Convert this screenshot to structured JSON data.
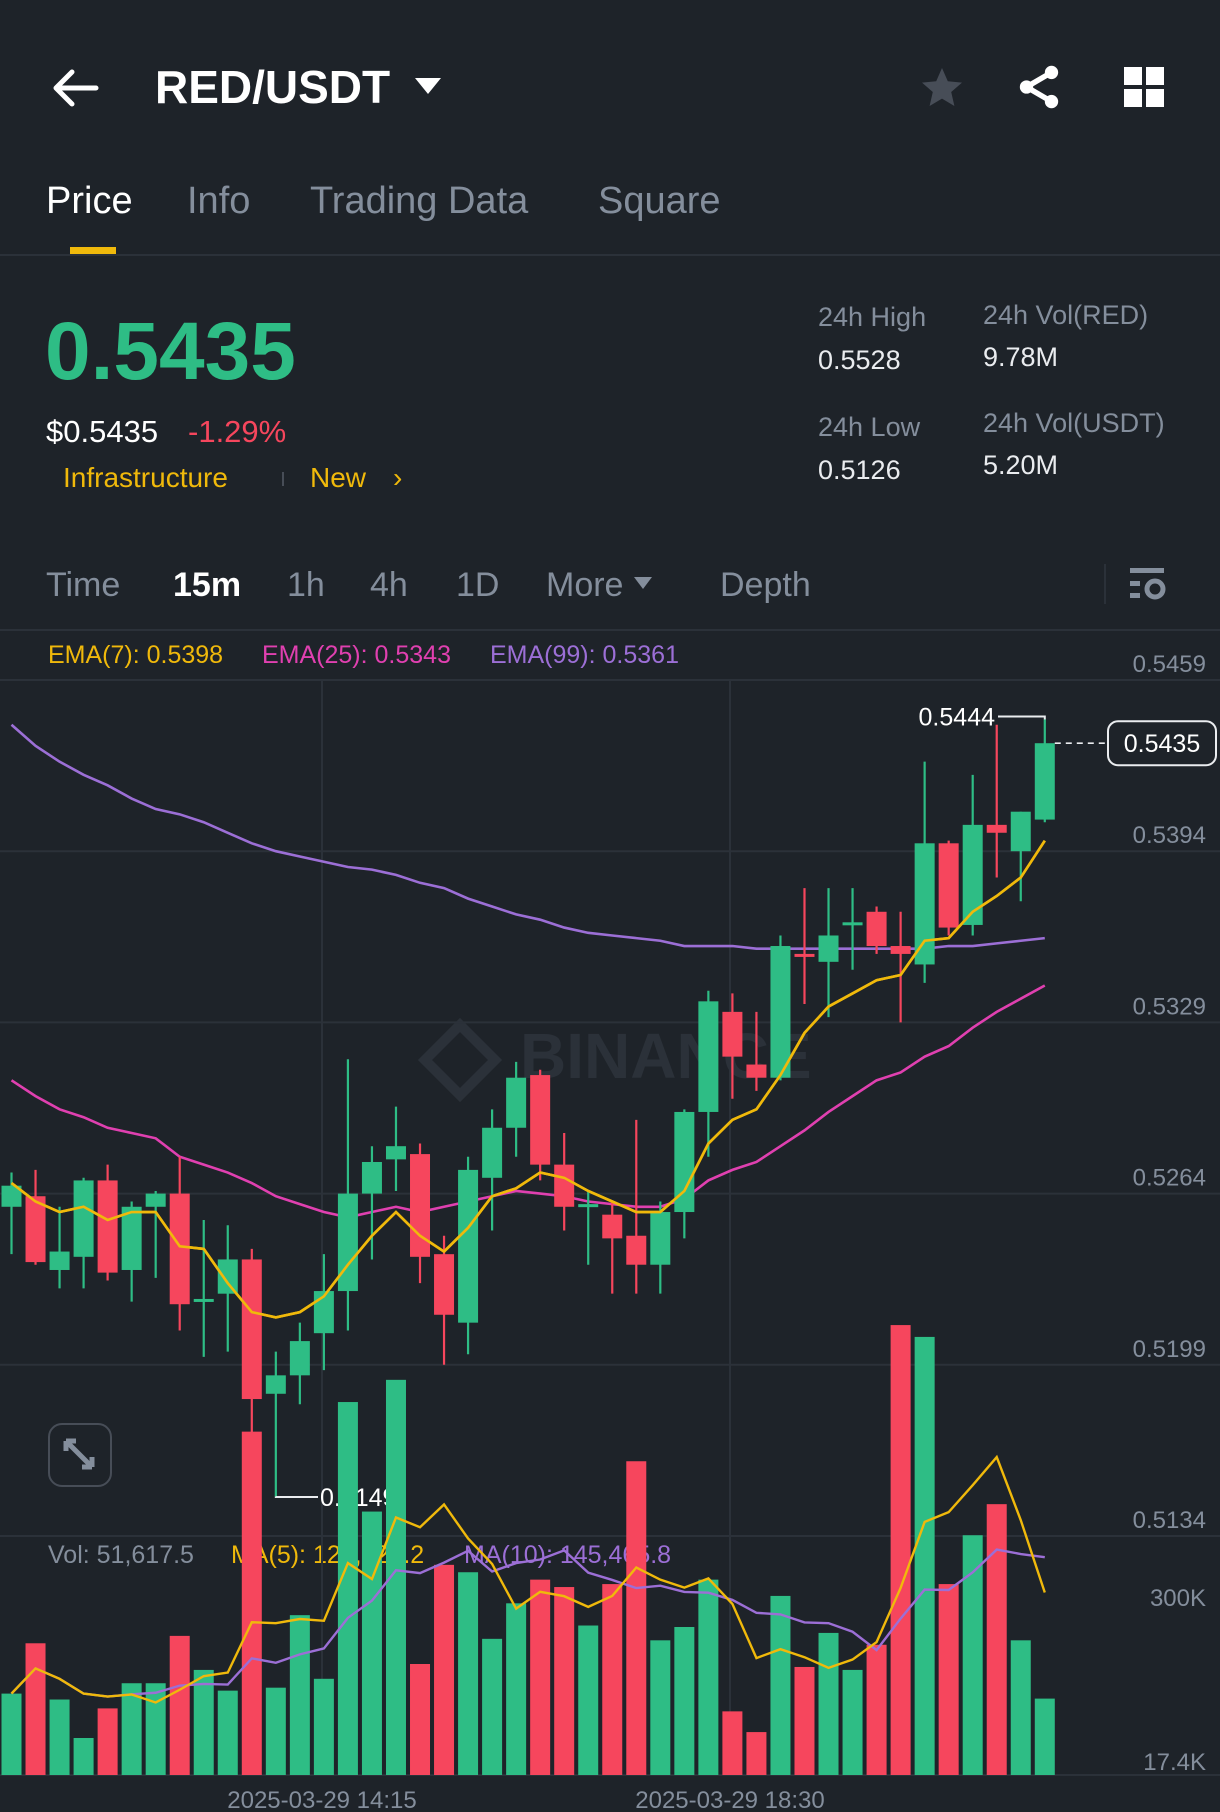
{
  "header": {
    "title": "RED/USDT"
  },
  "tabs": [
    {
      "label": "Price"
    },
    {
      "label": "Info"
    },
    {
      "label": "Trading Data"
    },
    {
      "label": "Square"
    }
  ],
  "ticker": {
    "last_price": "0.5435",
    "usd_price": "$0.5435",
    "change": "-1.29%",
    "tag1": "Infrastructure",
    "tag2": "New",
    "stats": {
      "high_label": "24h High",
      "high": "0.5528",
      "low_label": "24h Low",
      "low": "0.5126",
      "vol_base_label": "24h Vol(RED)",
      "vol_base": "9.78M",
      "vol_quote_label": "24h Vol(USDT)",
      "vol_quote": "5.20M"
    }
  },
  "intervals": [
    {
      "label": "Time"
    },
    {
      "label": "15m"
    },
    {
      "label": "1h"
    },
    {
      "label": "4h"
    },
    {
      "label": "1D"
    },
    {
      "label": "More"
    },
    {
      "label": "Depth"
    }
  ],
  "indicators": {
    "ema7": "EMA(7): 0.5398",
    "ema25": "EMA(25): 0.5343",
    "ema99": "EMA(99): 0.5361",
    "vol": "Vol: 51,617.5",
    "ma5": "MA(5): 121,821.2",
    "ma10": "MA(10): 145,465.8"
  },
  "colors": {
    "up": "#2ebd85",
    "down": "#f6465d",
    "ema7": "#f0b90b",
    "ema25": "#e040b0",
    "ema99": "#9c6fd6",
    "accent": "#f0b90b"
  },
  "chart_data": {
    "type": "candlestick",
    "price_axis": {
      "min": 0.5134,
      "max": 0.5459,
      "ticks": [
        "0.5459",
        "0.5394",
        "0.5329",
        "0.5264",
        "0.5199",
        "0.5134"
      ]
    },
    "volume_axis": {
      "ticks": [
        "300K",
        "17.4K"
      ]
    },
    "x_ticks": [
      "2025-03-29 14:15",
      "2025-03-29 18:30"
    ],
    "high_label": "0.5444",
    "low_label": "0.5149",
    "last_label": "0.5435",
    "ohlc": [
      [
        0.5259,
        0.5272,
        0.5241,
        0.5267
      ],
      [
        0.5263,
        0.5273,
        0.5237,
        0.5238
      ],
      [
        0.5235,
        0.5259,
        0.5228,
        0.5242
      ],
      [
        0.524,
        0.527,
        0.5228,
        0.5269
      ],
      [
        0.5269,
        0.5275,
        0.5231,
        0.5234
      ],
      [
        0.5235,
        0.5261,
        0.5223,
        0.5259
      ],
      [
        0.5259,
        0.5265,
        0.5232,
        0.5264
      ],
      [
        0.5264,
        0.5278,
        0.5212,
        0.5222
      ],
      [
        0.5223,
        0.5254,
        0.5202,
        0.5224
      ],
      [
        0.5226,
        0.5252,
        0.5204,
        0.5239
      ],
      [
        0.5239,
        0.5243,
        0.5171,
        0.5186
      ],
      [
        0.5188,
        0.5204,
        0.5149,
        0.5195
      ],
      [
        0.5195,
        0.5215,
        0.5184,
        0.5208
      ],
      [
        0.5211,
        0.5241,
        0.5197,
        0.5227
      ],
      [
        0.5227,
        0.5315,
        0.5212,
        0.5264
      ],
      [
        0.5264,
        0.5282,
        0.5239,
        0.5276
      ],
      [
        0.5277,
        0.5297,
        0.5265,
        0.5282
      ],
      [
        0.5279,
        0.5283,
        0.523,
        0.524
      ],
      [
        0.5241,
        0.5248,
        0.5199,
        0.5218
      ],
      [
        0.5215,
        0.5278,
        0.5203,
        0.5273
      ],
      [
        0.527,
        0.5296,
        0.525,
        0.5289
      ],
      [
        0.5289,
        0.5314,
        0.5278,
        0.5308
      ],
      [
        0.5309,
        0.5311,
        0.5269,
        0.5275
      ],
      [
        0.5275,
        0.5287,
        0.525,
        0.5259
      ],
      [
        0.5259,
        0.5265,
        0.5237,
        0.526
      ],
      [
        0.5256,
        0.5261,
        0.5226,
        0.5247
      ],
      [
        0.5248,
        0.5292,
        0.5226,
        0.5237
      ],
      [
        0.5237,
        0.5261,
        0.5226,
        0.5257
      ],
      [
        0.5257,
        0.5296,
        0.5247,
        0.5295
      ],
      [
        0.5295,
        0.5341,
        0.5278,
        0.5337
      ],
      [
        0.5333,
        0.534,
        0.53,
        0.5316
      ],
      [
        0.5313,
        0.5333,
        0.5303,
        0.5308
      ],
      [
        0.5308,
        0.5362,
        0.5307,
        0.5358
      ],
      [
        0.5355,
        0.538,
        0.5336,
        0.5354
      ],
      [
        0.5352,
        0.538,
        0.5331,
        0.5362
      ],
      [
        0.5366,
        0.538,
        0.5349,
        0.5367
      ],
      [
        0.5371,
        0.5373,
        0.5355,
        0.5358
      ],
      [
        0.5358,
        0.5371,
        0.5329,
        0.5355
      ],
      [
        0.5351,
        0.5428,
        0.5344,
        0.5397
      ],
      [
        0.5397,
        0.5398,
        0.5362,
        0.5365
      ],
      [
        0.5366,
        0.5423,
        0.5362,
        0.5404
      ],
      [
        0.5404,
        0.5442,
        0.5384,
        0.5401
      ],
      [
        0.5394,
        0.5409,
        0.5375,
        0.5409
      ],
      [
        0.5406,
        0.5444,
        0.5405,
        0.5435
      ]
    ],
    "ema7": [
      0.5268,
      0.5261,
      0.5257,
      0.5259,
      0.5254,
      0.5257,
      0.5257,
      0.5244,
      0.5243,
      0.523,
      0.5219,
      0.5217,
      0.5219,
      0.5225,
      0.5237,
      0.5248,
      0.5257,
      0.5248,
      0.5242,
      0.5251,
      0.5263,
      0.5266,
      0.5272,
      0.527,
      0.5265,
      0.5261,
      0.5257,
      0.5257,
      0.5265,
      0.5283,
      0.5292,
      0.5296,
      0.5309,
      0.5325,
      0.5335,
      0.534,
      0.5345,
      0.5347,
      0.536,
      0.5361,
      0.5371,
      0.5377,
      0.5384,
      0.5398
    ],
    "ema25": [
      0.5307,
      0.5301,
      0.5296,
      0.5293,
      0.5289,
      0.5287,
      0.5285,
      0.5278,
      0.5275,
      0.5272,
      0.5268,
      0.5263,
      0.526,
      0.5257,
      0.5255,
      0.5257,
      0.5259,
      0.5257,
      0.5259,
      0.5261,
      0.5263,
      0.5265,
      0.5264,
      0.5263,
      0.5261,
      0.526,
      0.5259,
      0.5259,
      0.5262,
      0.5269,
      0.5273,
      0.5276,
      0.5282,
      0.5288,
      0.5295,
      0.5301,
      0.5307,
      0.531,
      0.5316,
      0.532,
      0.5327,
      0.5333,
      0.5338,
      0.5343
    ],
    "ema99": [
      0.5442,
      0.5434,
      0.5428,
      0.5423,
      0.5419,
      0.5414,
      0.541,
      0.5408,
      0.5405,
      0.5401,
      0.5397,
      0.5394,
      0.5392,
      0.539,
      0.5388,
      0.5387,
      0.5385,
      0.5382,
      0.538,
      0.5376,
      0.5373,
      0.537,
      0.5368,
      0.5365,
      0.5363,
      0.5362,
      0.5361,
      0.536,
      0.5358,
      0.5358,
      0.5358,
      0.5357,
      0.5357,
      0.5357,
      0.5357,
      0.5357,
      0.5357,
      0.5357,
      0.5357,
      0.5358,
      0.5358,
      0.5359,
      0.536,
      0.5361
    ],
    "volume": [
      55000,
      89000,
      51000,
      25000,
      45000,
      62000,
      62000,
      94000,
      71000,
      57000,
      232000,
      59000,
      108000,
      65000,
      252000,
      178000,
      267000,
      75000,
      142000,
      137000,
      92000,
      116000,
      132000,
      127000,
      101000,
      129000,
      212000,
      91000,
      100000,
      132000,
      43000,
      29000,
      121000,
      73000,
      96000,
      71000,
      88000,
      304000,
      296000,
      129000,
      162000,
      183000,
      91000,
      51617.5
    ]
  }
}
